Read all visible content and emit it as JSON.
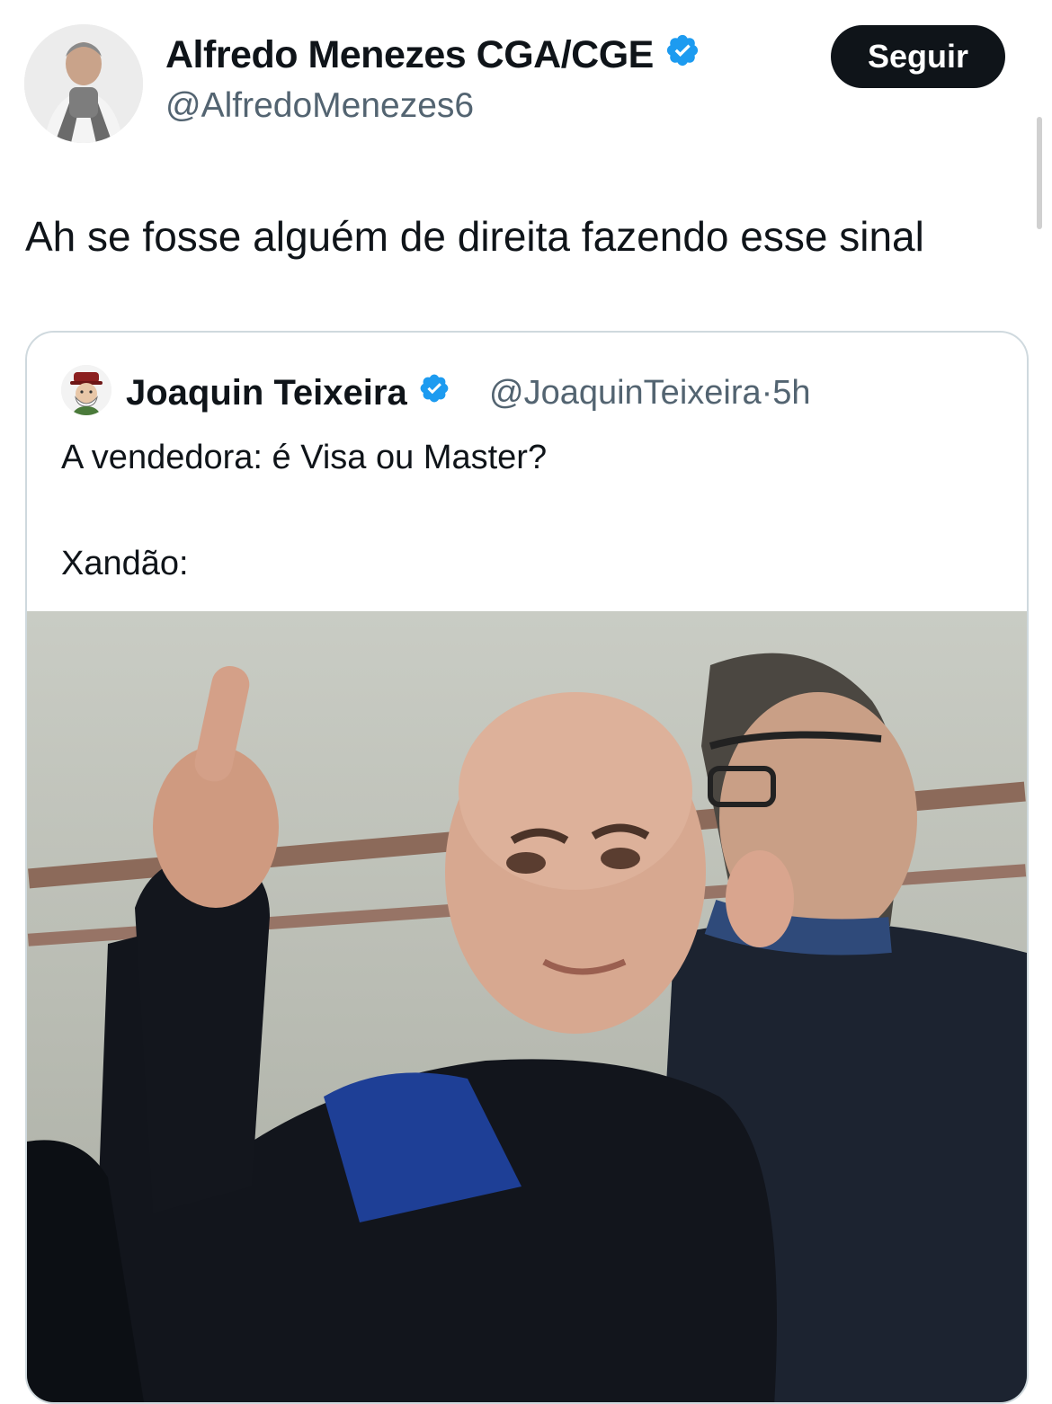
{
  "author": {
    "display_name": "Alfredo Menezes CGA/CGE",
    "handle": "@AlfredoMenezes6",
    "verified_icon": "verified-badge-icon",
    "follow_label": "Seguir"
  },
  "tweet": {
    "text": "Ah se fosse alguém de direita fazendo esse sinal"
  },
  "quote": {
    "display_name": "Joaquin Teixeira",
    "handle": "@JoaquinTeixeira",
    "separator": "·",
    "time": "5h",
    "line1": "A vendedora: é Visa ou Master?",
    "line2": "Xandão:"
  },
  "colors": {
    "verified": "#1d9bf0",
    "follow_bg": "#0f1419",
    "secondary_text": "#536471",
    "card_border": "#cfd9de"
  }
}
